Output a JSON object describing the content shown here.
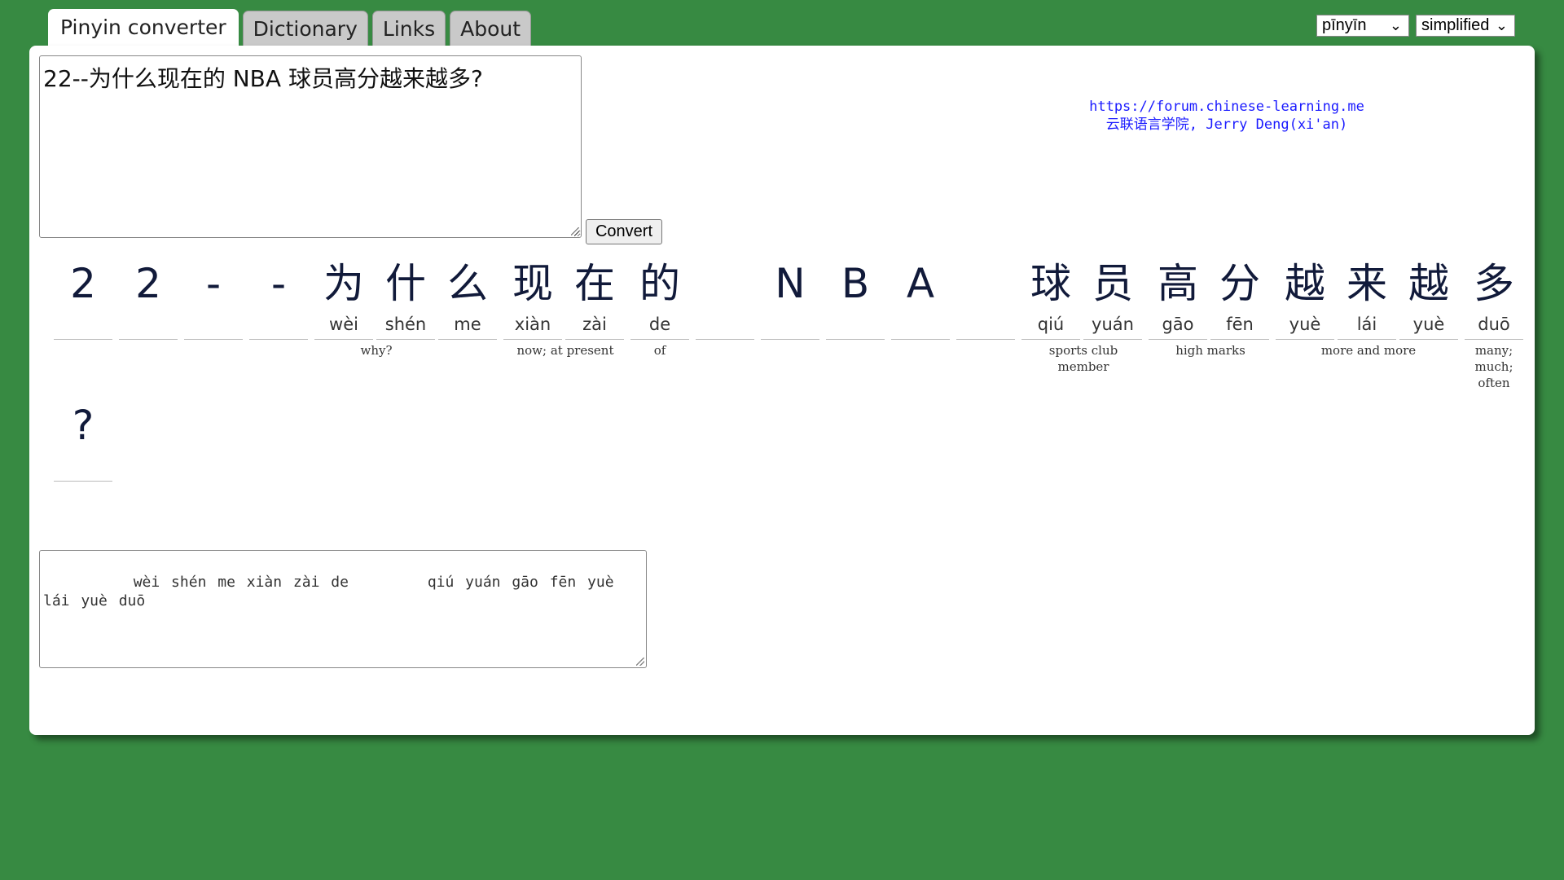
{
  "tabs": [
    {
      "label": "Pinyin converter"
    },
    {
      "label": "Dictionary"
    },
    {
      "label": "Links"
    },
    {
      "label": "About"
    }
  ],
  "selects": {
    "romanization": "pīnyīn",
    "script": "simplified"
  },
  "input": {
    "value": "22--为什么现在的 NBA 球员高分越来越多?"
  },
  "convert_label": "Convert",
  "credit": {
    "url": "https://forum.chinese-learning.me",
    "name": "云联语言学院, Jerry Deng(xi'an)"
  },
  "cells": [
    {
      "hz": "2",
      "py": ""
    },
    {
      "hz": "2",
      "py": ""
    },
    {
      "hz": "-",
      "py": ""
    },
    {
      "hz": "-",
      "py": ""
    },
    {
      "hz": "为",
      "py": "wèi"
    },
    {
      "hz": "什",
      "py": "shén"
    },
    {
      "hz": "么",
      "py": "me"
    },
    {
      "hz": "现",
      "py": "xiàn"
    },
    {
      "hz": "在",
      "py": "zài"
    },
    {
      "hz": "的",
      "py": "de"
    },
    {
      "hz": "",
      "py": ""
    },
    {
      "hz": "N",
      "py": ""
    },
    {
      "hz": "B",
      "py": ""
    },
    {
      "hz": "A",
      "py": ""
    },
    {
      "hz": "",
      "py": ""
    },
    {
      "hz": "球",
      "py": "qiú"
    },
    {
      "hz": "员",
      "py": "yuán"
    },
    {
      "hz": "高",
      "py": "gāo"
    },
    {
      "hz": "分",
      "py": "fēn"
    },
    {
      "hz": "越",
      "py": "yuè"
    },
    {
      "hz": "来",
      "py": "lái"
    },
    {
      "hz": "越",
      "py": "yuè"
    },
    {
      "hz": "多",
      "py": "duō"
    },
    {
      "hz": "?",
      "py": ""
    }
  ],
  "glosses": [
    {
      "text": "why?"
    },
    {
      "text": "now; at present"
    },
    {
      "text": "of"
    },
    {
      "text": "sports club member"
    },
    {
      "text": "high marks"
    },
    {
      "text": "more and more"
    },
    {
      "text": "many;\nmuch;\noften"
    }
  ],
  "output": {
    "value": "    wèi shén me xiàn zài de       qiú yuán gāo fēn yuè lái yuè duō"
  },
  "colors": {
    "background": "#378a42",
    "link": "#1a1aff"
  }
}
